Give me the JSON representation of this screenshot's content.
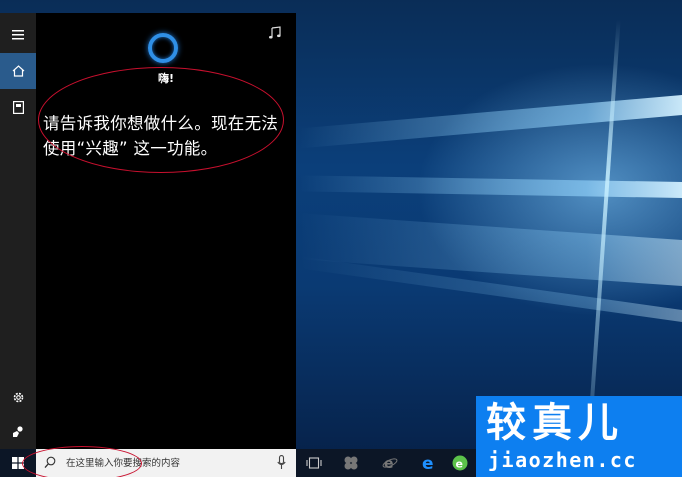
{
  "cortana": {
    "greeting": "嗨!",
    "message": "请告诉我你想做什么。现在无法使用“兴趣” 这一功能。"
  },
  "sidebar": {
    "items": [
      {
        "icon": "hamburger-menu-icon"
      },
      {
        "icon": "home-icon",
        "active": true
      },
      {
        "icon": "notebook-icon"
      },
      {
        "icon": "settings-gear-icon"
      },
      {
        "icon": "feedback-icon"
      }
    ]
  },
  "search": {
    "placeholder": "在这里输入你要搜索的内容"
  },
  "taskbar": {
    "icons": [
      "windows-start-icon",
      "task-view-icon",
      "app-icon",
      "internet-explorer-icon",
      "edge-icon",
      "green-browser-icon"
    ]
  },
  "watermark": {
    "title": "较真儿",
    "url": "jiaozhen.cc"
  },
  "colors": {
    "accent": "#2f8fe6",
    "annotation": "#c8102e",
    "watermark_bg": "#0d7ff0"
  }
}
